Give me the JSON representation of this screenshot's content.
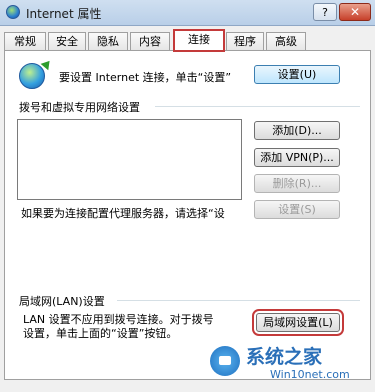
{
  "window": {
    "title": "Internet 属性",
    "help_label": "?",
    "close_label": "✕"
  },
  "tabs": [
    {
      "label": "常规"
    },
    {
      "label": "安全"
    },
    {
      "label": "隐私"
    },
    {
      "label": "内容"
    },
    {
      "label": "连接",
      "active": true
    },
    {
      "label": "程序"
    },
    {
      "label": "高级"
    }
  ],
  "connect": {
    "text": "要设置 Internet 连接，单击“设置”",
    "setup_label": "设置(U)"
  },
  "dialup": {
    "heading": "拨号和虚拟专用网络设置",
    "add_label": "添加(D)...",
    "add_vpn_label": "添加 VPN(P)...",
    "remove_label": "删除(R)...",
    "settings_label": "设置(S)",
    "proxy_text": "如果要为连接配置代理服务器，请选择“设"
  },
  "lan": {
    "heading": "局域网(LAN)设置",
    "text_line1": "LAN 设置不应用到拨号连接。对于拨号",
    "text_line2": "设置，单击上面的“设置”按钮。",
    "button_label": "局域网设置(L)"
  },
  "watermark": {
    "big": "系统之家",
    "small": "Win10net.com"
  }
}
